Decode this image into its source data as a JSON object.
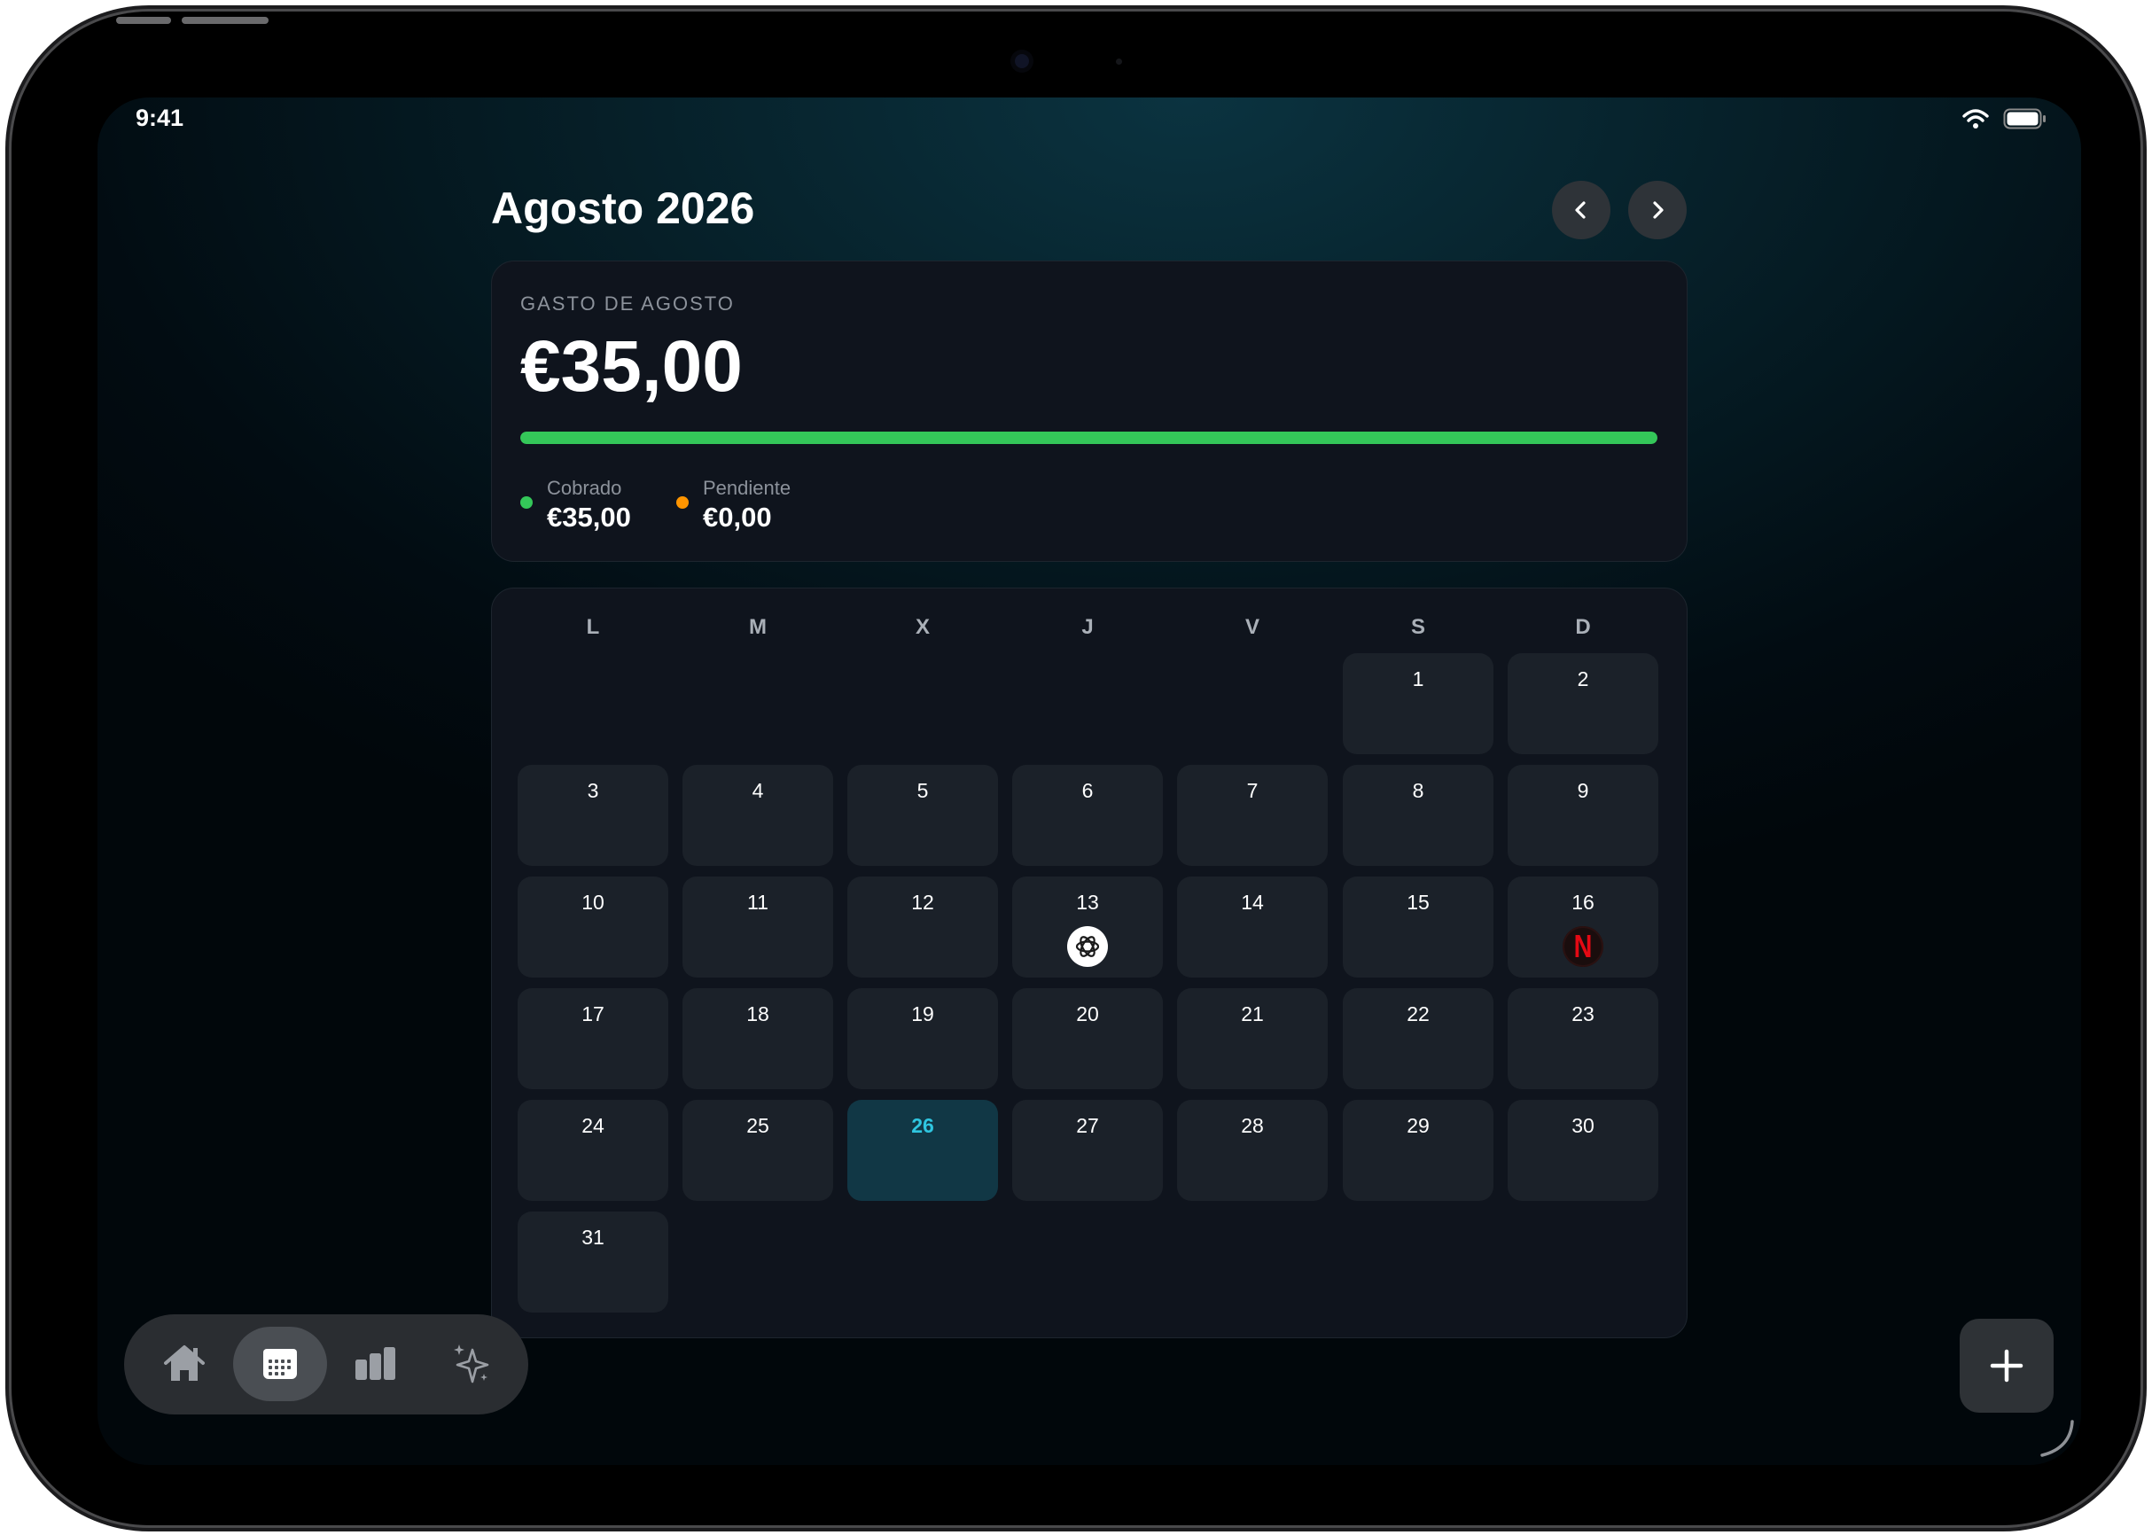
{
  "status_bar": {
    "time": "9:41"
  },
  "header": {
    "title": "Agosto 2026"
  },
  "summary": {
    "label": "GASTO DE AGOSTO",
    "amount": "€35,00",
    "progress_fraction": 1.0,
    "legend": [
      {
        "label": "Cobrado",
        "value": "€35,00",
        "color": "#34c759"
      },
      {
        "label": "Pendiente",
        "value": "€0,00",
        "color": "#ff9500"
      }
    ]
  },
  "calendar": {
    "weekdays": [
      "L",
      "M",
      "X",
      "J",
      "V",
      "S",
      "D"
    ],
    "days": [
      "1",
      "2",
      "3",
      "4",
      "5",
      "6",
      "7",
      "8",
      "9",
      "10",
      "11",
      "12",
      "13",
      "14",
      "15",
      "16",
      "17",
      "18",
      "19",
      "20",
      "21",
      "22",
      "23",
      "24",
      "25",
      "26",
      "27",
      "28",
      "29",
      "30",
      "31"
    ],
    "today": "26",
    "subscriptions": [
      {
        "day": "13",
        "icon": "chatgpt-icon"
      },
      {
        "day": "16",
        "icon": "netflix-icon",
        "letter": "N"
      }
    ]
  },
  "tabbar": {
    "tabs": [
      {
        "name": "home",
        "icon": "house-icon"
      },
      {
        "name": "calendar",
        "icon": "calendar-icon",
        "active": true
      },
      {
        "name": "stats",
        "icon": "bar-chart-icon"
      },
      {
        "name": "ai",
        "icon": "sparkles-icon"
      }
    ]
  },
  "colors": {
    "accent": "#2fc6e0",
    "paid": "#34c759",
    "pending": "#ff9500",
    "netflix_red": "#e50914"
  }
}
